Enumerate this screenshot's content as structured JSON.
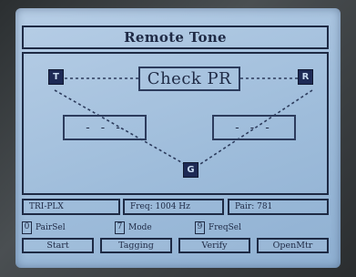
{
  "screen": {
    "title": "Remote Tone",
    "check_label": "Check PR",
    "nodes": {
      "top_left": "T",
      "top_right": "R",
      "bottom": "G"
    },
    "left_value": "- - -",
    "right_value": "- - -"
  },
  "status": {
    "mode": "TRI-PLX",
    "freq": "Freq: 1004 Hz",
    "pair": "Pair:  781"
  },
  "keys": [
    {
      "num": "0",
      "label": "PairSel"
    },
    {
      "num": "7",
      "label": "Mode"
    },
    {
      "num": "9",
      "label": "FreqSel"
    }
  ],
  "softkeys": [
    "Start",
    "Tagging",
    "Verify",
    "OpenMtr"
  ],
  "colors": {
    "screen": "#a9c5e2",
    "ink": "#1e2a44",
    "bezel": "#3b3f40"
  }
}
